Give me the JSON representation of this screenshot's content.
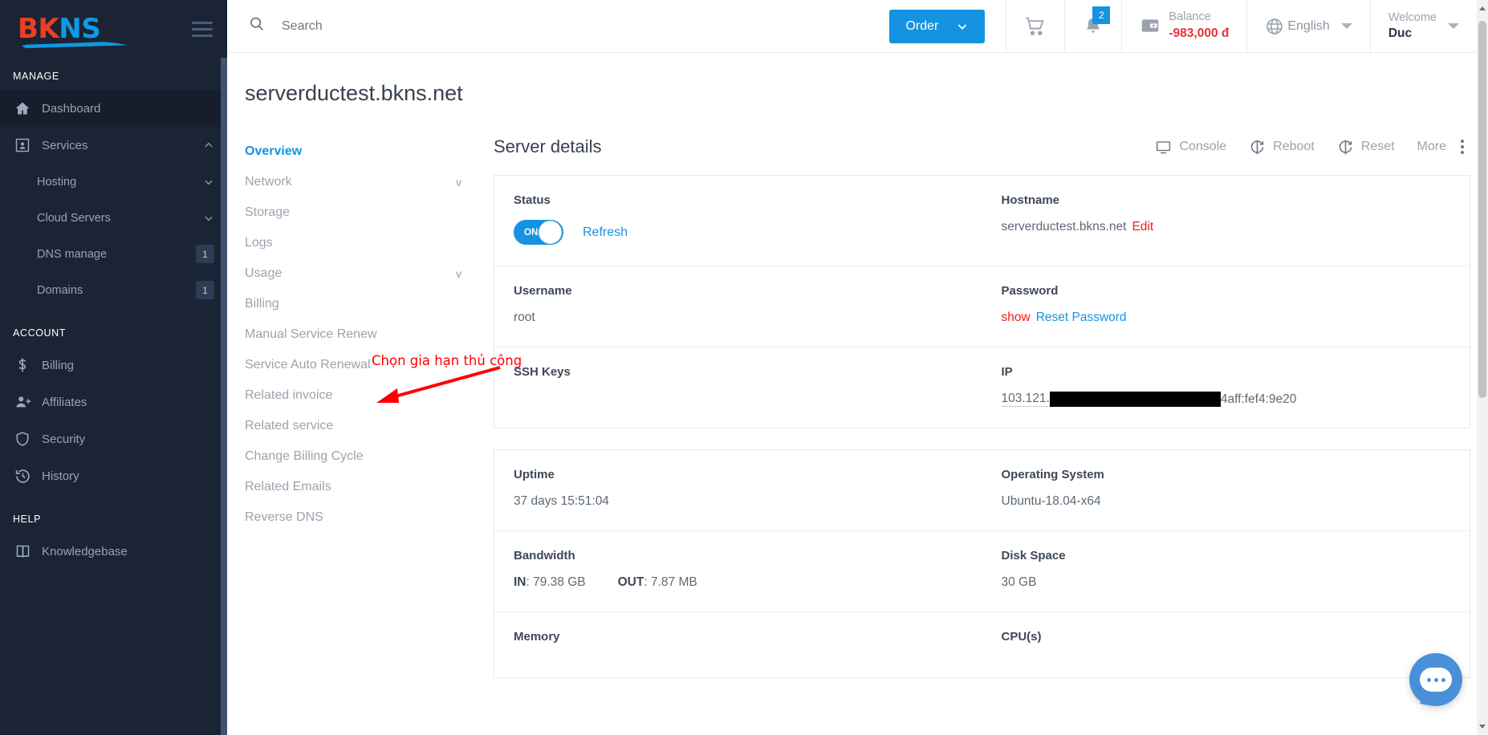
{
  "brand": {
    "logo_part1": "BK",
    "logo_part2": "NS"
  },
  "sidebar": {
    "section_manage": "MANAGE",
    "section_account": "ACCOUNT",
    "section_help": "HELP",
    "manage_items": [
      {
        "label": "Dashboard",
        "icon": "home-icon",
        "badge": "",
        "chevron": ""
      },
      {
        "label": "Services",
        "icon": "services-icon",
        "badge": "",
        "chevron": "up"
      },
      {
        "label": "Hosting",
        "icon": "",
        "badge": "",
        "chevron": "down"
      },
      {
        "label": "Cloud Servers",
        "icon": "",
        "badge": "",
        "chevron": "down"
      },
      {
        "label": "DNS manage",
        "icon": "",
        "badge": "1",
        "chevron": ""
      },
      {
        "label": "Domains",
        "icon": "",
        "badge": "1",
        "chevron": ""
      }
    ],
    "account_items": [
      {
        "label": "Billing",
        "icon": "dollar-icon"
      },
      {
        "label": "Affiliates",
        "icon": "user-plus-icon"
      },
      {
        "label": "Security",
        "icon": "shield-icon"
      },
      {
        "label": "History",
        "icon": "history-icon"
      }
    ],
    "help_items": [
      {
        "label": "Knowledgebase",
        "icon": "book-icon"
      }
    ]
  },
  "topbar": {
    "search_placeholder": "Search",
    "search_value": "",
    "order_label": "Order",
    "notification_count": "2",
    "balance_label": "Balance",
    "balance_amount": "-983,000 đ",
    "language": "English",
    "welcome_label": "Welcome",
    "user_name": "Duc"
  },
  "page": {
    "title": "serverductest.bkns.net"
  },
  "leftnav": {
    "items": [
      {
        "label": "Overview",
        "chevron": "",
        "active": true
      },
      {
        "label": "Network",
        "chevron": "v",
        "active": false
      },
      {
        "label": "Storage",
        "chevron": "",
        "active": false
      },
      {
        "label": "Logs",
        "chevron": "",
        "active": false
      },
      {
        "label": "Usage",
        "chevron": "v",
        "active": false
      },
      {
        "label": "Billing",
        "chevron": "",
        "active": false
      },
      {
        "label": "Manual Service Renew",
        "chevron": "",
        "active": false
      },
      {
        "label": "Service Auto Renewal",
        "chevron": "",
        "active": false
      },
      {
        "label": "Related invoice",
        "chevron": "",
        "active": false
      },
      {
        "label": "Related service",
        "chevron": "",
        "active": false
      },
      {
        "label": "Change Billing Cycle",
        "chevron": "",
        "active": false
      },
      {
        "label": "Related Emails",
        "chevron": "",
        "active": false
      },
      {
        "label": "Reverse DNS",
        "chevron": "",
        "active": false
      }
    ]
  },
  "details": {
    "title": "Server details",
    "actions": [
      {
        "label": "Console",
        "icon": "monitor-icon"
      },
      {
        "label": "Reboot",
        "icon": "refresh-icon"
      },
      {
        "label": "Reset",
        "icon": "refresh-icon"
      },
      {
        "label": "More",
        "icon": ""
      }
    ],
    "fields": {
      "status_label": "Status",
      "status_toggle": "ON",
      "refresh_link": "Refresh",
      "hostname_label": "Hostname",
      "hostname_value": "serverductest.bkns.net",
      "hostname_edit": "Edit",
      "username_label": "Username",
      "username_value": "root",
      "password_label": "Password",
      "password_show": "show",
      "password_reset": "Reset Password",
      "sshkeys_label": "SSH Keys",
      "sshkeys_value": "",
      "ip_label": "IP",
      "ip_prefix": "103.121.",
      "ip_suffix": "4aff:fef4:9e20",
      "uptime_label": "Uptime",
      "uptime_value": "37 days 15:51:04",
      "os_label": "Operating System",
      "os_value": "Ubuntu-18.04-x64",
      "bandwidth_label": "Bandwidth",
      "bandwidth_in_key": "IN",
      "bandwidth_in_value": "79.38 GB",
      "bandwidth_out_key": "OUT",
      "bandwidth_out_value": "7.87 MB",
      "disk_label": "Disk Space",
      "disk_value": "30 GB",
      "memory_label": "Memory",
      "cpu_label": "CPU(s)"
    }
  },
  "annotation": {
    "text": "Chọn gia hạn thủ công",
    "color": "#ff0000"
  },
  "colors": {
    "accent": "#1593e0",
    "sidebar_bg": "#1b2434",
    "danger": "#e8313a",
    "annotation": "#ff0000"
  }
}
